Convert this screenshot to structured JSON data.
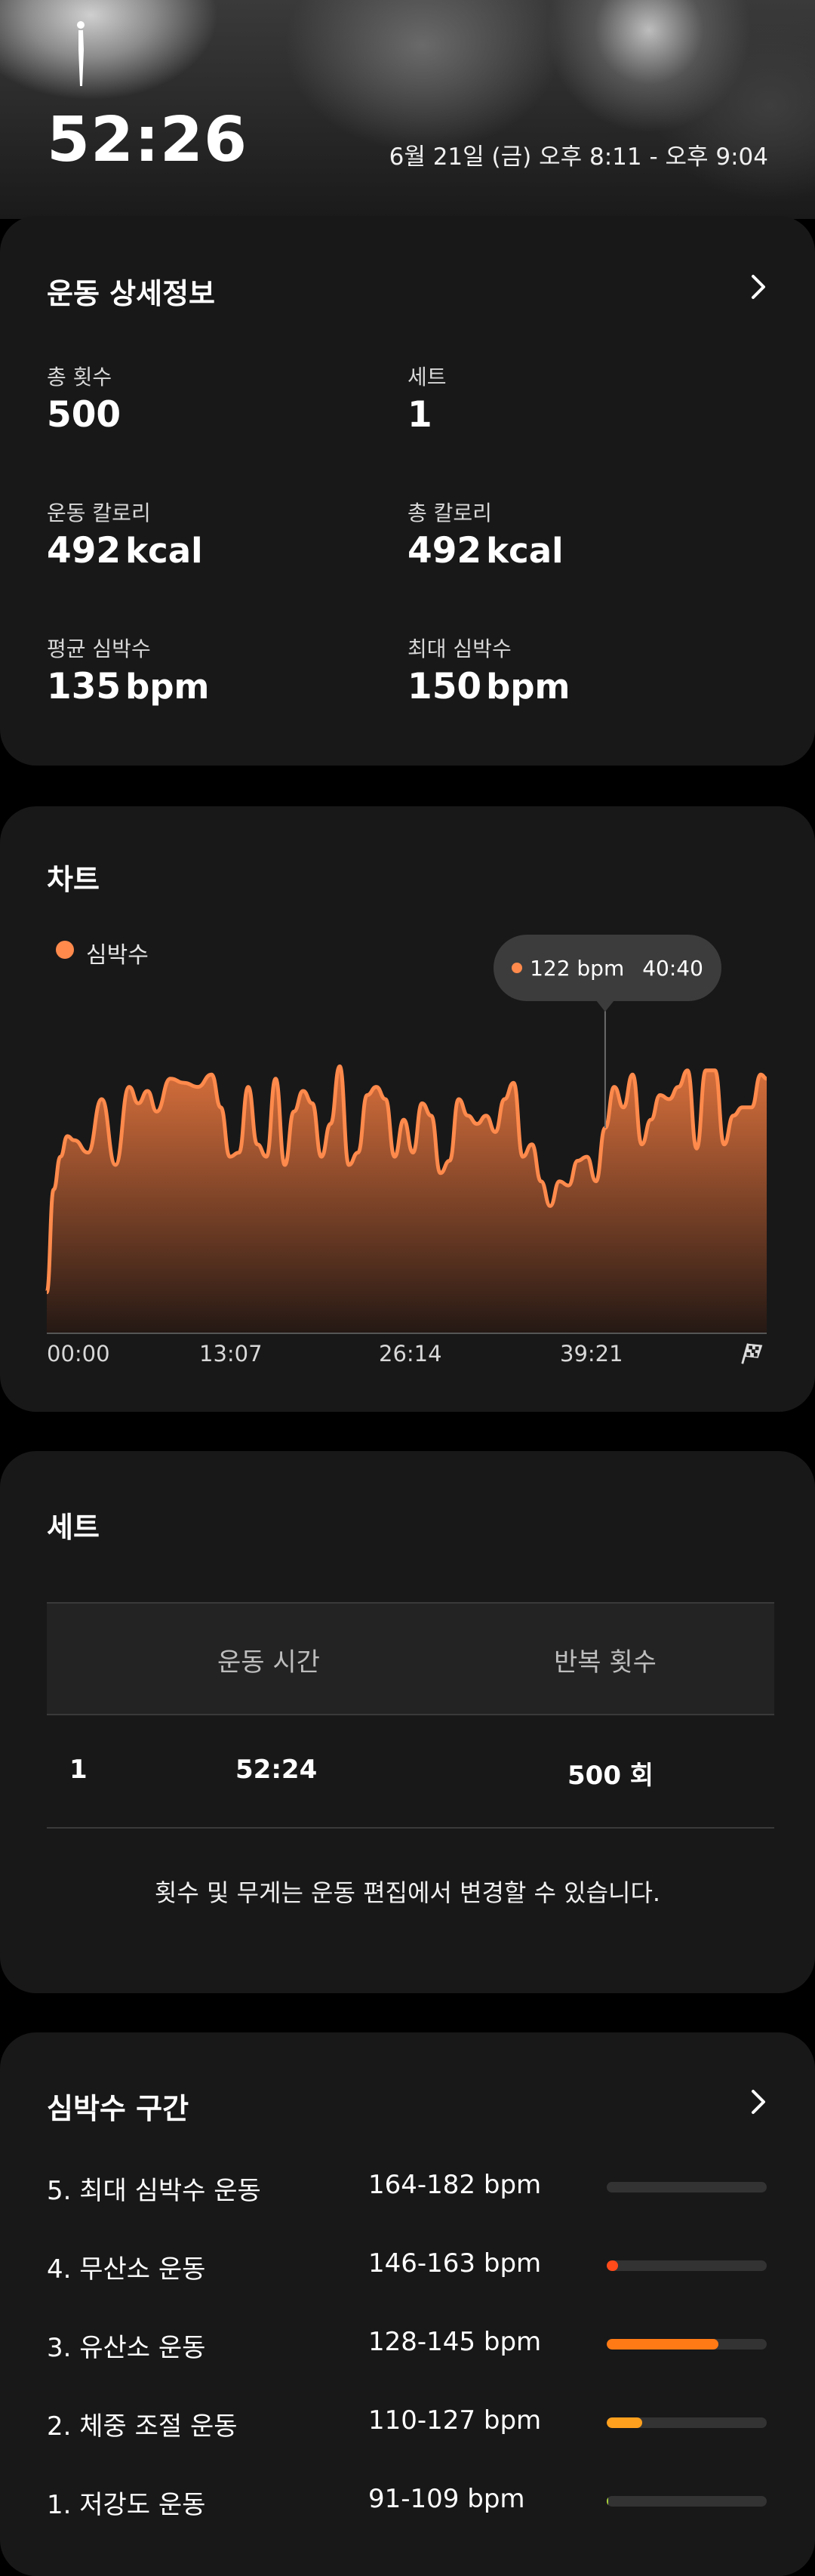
{
  "header": {
    "duration": "52:26",
    "date_range": "6월 21일 (금) 오후 8:11 - 오후 9:04",
    "icon": "person-standing-icon"
  },
  "details": {
    "title": "운동 상세정보",
    "stats": [
      {
        "label": "총 횟수",
        "value": "500",
        "unit": ""
      },
      {
        "label": "세트",
        "value": "1",
        "unit": ""
      },
      {
        "label": "운동 칼로리",
        "value": "492",
        "unit": "kcal"
      },
      {
        "label": "총 칼로리",
        "value": "492",
        "unit": "kcal"
      },
      {
        "label": "평균 심박수",
        "value": "135",
        "unit": "bpm"
      },
      {
        "label": "최대 심박수",
        "value": "150",
        "unit": "bpm"
      }
    ]
  },
  "chart": {
    "title": "차트",
    "legend": "심박수",
    "tooltip_value": "122 bpm",
    "tooltip_time": "40:40",
    "colors": {
      "line": "#ff8a4c",
      "fill_top": "#d9703c",
      "fill_bottom": "#241814"
    },
    "end_icon": "finish-flag-icon"
  },
  "chart_data": {
    "type": "area",
    "title": "",
    "xlabel": "",
    "ylabel": "",
    "x_ticks": [
      "00:00",
      "13:07",
      "26:14",
      "39:21"
    ],
    "xlim": [
      "00:00",
      "52:26"
    ],
    "series": [
      {
        "name": "심박수",
        "x": [
          "00:00",
          "00:30",
          "01:00",
          "01:30",
          "02:00",
          "03:00",
          "04:00",
          "05:00",
          "06:00",
          "06:40",
          "07:20",
          "08:00",
          "09:00",
          "10:00",
          "11:00",
          "12:00",
          "12:40",
          "13:20",
          "14:00",
          "14:40",
          "15:20",
          "16:00",
          "16:40",
          "17:20",
          "18:00",
          "18:40",
          "19:20",
          "20:00",
          "20:40",
          "21:20",
          "22:00",
          "22:40",
          "23:20",
          "24:00",
          "24:40",
          "25:20",
          "26:00",
          "26:40",
          "27:20",
          "28:00",
          "28:40",
          "29:20",
          "30:00",
          "30:40",
          "31:20",
          "32:00",
          "32:40",
          "33:20",
          "34:00",
          "34:40",
          "35:20",
          "36:00",
          "36:40",
          "37:20",
          "38:00",
          "38:40",
          "39:20",
          "40:00",
          "40:40",
          "41:20",
          "42:00",
          "42:40",
          "43:20",
          "44:00",
          "44:40",
          "45:20",
          "46:00",
          "46:40",
          "47:20",
          "48:00",
          "48:40",
          "49:20",
          "50:00",
          "50:40",
          "51:20",
          "52:00",
          "52:26"
        ],
        "values": [
          95,
          120,
          128,
          133,
          132,
          129,
          142,
          126,
          145,
          141,
          144,
          139,
          147,
          146,
          145,
          148,
          140,
          128,
          129,
          145,
          131,
          128,
          147,
          126,
          139,
          144,
          141,
          128,
          136,
          150,
          126,
          129,
          143,
          145,
          142,
          128,
          137,
          129,
          141,
          138,
          124,
          127,
          142,
          138,
          136,
          138,
          134,
          142,
          146,
          128,
          131,
          122,
          116,
          122,
          121,
          127,
          128,
          122,
          135,
          145,
          140,
          148,
          131,
          137,
          143,
          142,
          145,
          149,
          130,
          149,
          149,
          131,
          138,
          140,
          140,
          148,
          147
        ]
      }
    ],
    "ylim": [
      85,
      160
    ],
    "grid": false,
    "legend_position": "top-left"
  },
  "sets": {
    "title": "세트",
    "columns": [
      "운동 시간",
      "반복 횟수"
    ],
    "rows": [
      {
        "index": "1",
        "time": "52:24",
        "reps": "500 회"
      }
    ],
    "note": "횟수 및 무게는 운동 편집에서 변경할 수 있습니다."
  },
  "zones": {
    "title": "심박수 구간",
    "items": [
      {
        "name": "5. 최대 심박수 운동",
        "range": "164-182 bpm",
        "fraction": 0,
        "color": "#ff5a1f"
      },
      {
        "name": "4. 무산소 운동",
        "range": "146-163 bpm",
        "fraction": 0.07,
        "color": "#ff4a1a"
      },
      {
        "name": "3. 유산소 운동",
        "range": "128-145 bpm",
        "fraction": 0.7,
        "color": "#ff7a14"
      },
      {
        "name": "2. 체중 조절 운동",
        "range": "110-127 bpm",
        "fraction": 0.22,
        "color": "#ffa01e"
      },
      {
        "name": "1. 저강도 운동",
        "range": "91-109 bpm",
        "fraction": 0.01,
        "color": "#a8d23c"
      }
    ]
  }
}
